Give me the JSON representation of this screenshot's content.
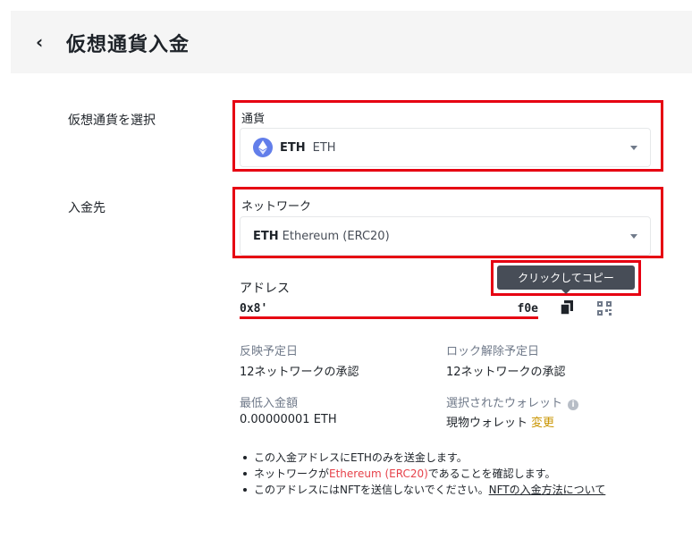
{
  "header": {
    "back_icon": "chevron-left-icon",
    "title": "仮想通貨入金"
  },
  "select_crypto": {
    "label": "仮想通貨を選択",
    "field_label": "通貨",
    "selected_symbol": "ETH",
    "selected_name": "ETH",
    "icon": "ethereum-icon"
  },
  "deposit_to": {
    "label": "入金先",
    "network_label": "ネットワーク",
    "network_symbol": "ETH",
    "network_name": "Ethereum (ERC20)"
  },
  "address": {
    "label": "アドレス",
    "value_start": "0x8'",
    "value_end": "f0e",
    "tooltip": "クリックしてコピー"
  },
  "info": {
    "arrival_label": "反映予定日",
    "arrival_value": "12ネットワークの承認",
    "unlock_label": "ロック解除予定日",
    "unlock_value": "12ネットワークの承認",
    "min_label": "最低入金額",
    "min_value": "0.00000001 ETH",
    "wallet_label": "選択されたウォレット",
    "wallet_value": "現物ウォレット",
    "wallet_change": "変更"
  },
  "notes": {
    "n1": "この入金アドレスにETHのみを送金します。",
    "n2_pre": "ネットワークが",
    "n2_red": "Ethereum (ERC20)",
    "n2_post": "であることを確認します。",
    "n3_pre": "このアドレスにはNFTを送信しないでください。",
    "n3_link": "NFTの入金方法について"
  },
  "colors": {
    "highlight": "#e60012",
    "accent": "#c99400",
    "eth": "#627eea"
  }
}
